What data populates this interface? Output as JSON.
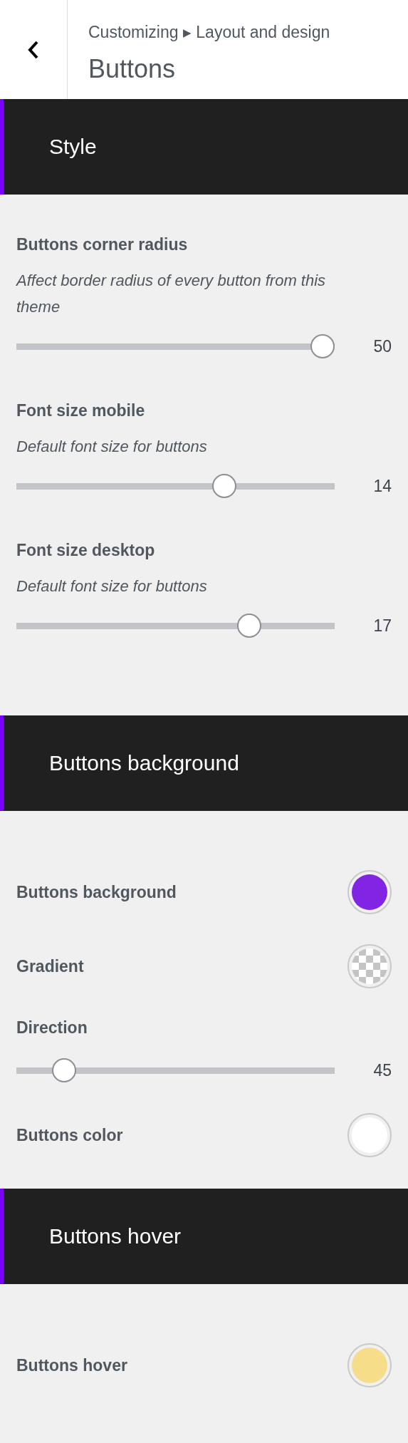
{
  "header": {
    "breadcrumb": "Customizing ▸ Layout and design",
    "title": "Buttons"
  },
  "sections": [
    {
      "title": "Style",
      "controls": [
        {
          "kind": "slider",
          "label": "Buttons corner radius",
          "description": "Affect border radius of every button from this theme",
          "level": 1,
          "value": "50"
        },
        {
          "kind": "slider",
          "label": "Font size mobile",
          "description": "Default font size for buttons",
          "level": 0.665,
          "value": "14"
        },
        {
          "kind": "slider",
          "label": "Font size desktop",
          "description": "Default font size for buttons",
          "level": 0.75,
          "value": "17"
        }
      ]
    },
    {
      "title": "Buttons background",
      "controls": [
        {
          "kind": "swatch",
          "label": "Buttons background",
          "color": "#8224e3"
        },
        {
          "kind": "checker",
          "label": "Gradient"
        },
        {
          "kind": "slider",
          "label": "Direction",
          "level": 0.12,
          "value": "45"
        },
        {
          "kind": "swatch",
          "label": "Buttons color",
          "color": "#ffffff"
        }
      ]
    },
    {
      "title": "Buttons hover",
      "controls": [
        {
          "kind": "swatch",
          "label": "Buttons hover",
          "color": "#f5dd8a"
        }
      ]
    }
  ]
}
